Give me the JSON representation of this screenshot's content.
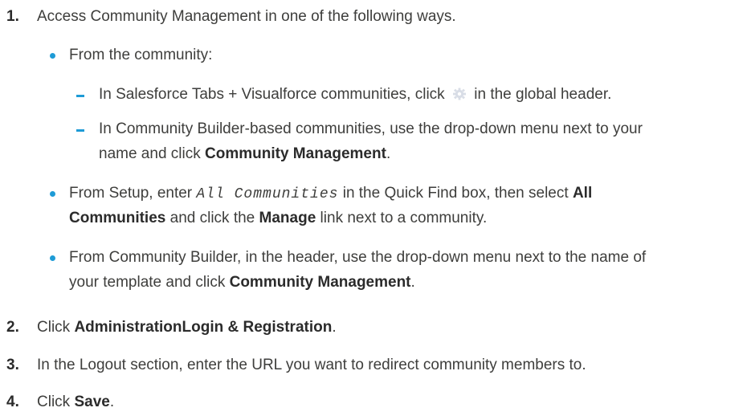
{
  "steps": [
    {
      "num": "1.",
      "text": "Access Community Management in one of the following ways."
    },
    {
      "num": "2.",
      "pre": "Click ",
      "bold": "AdministrationLogin & Registration",
      "post": "."
    },
    {
      "num": "3.",
      "text": "In the Logout section, enter the URL you want to redirect community members to."
    },
    {
      "num": "4.",
      "pre": "Click ",
      "bold": "Save",
      "post": "."
    }
  ],
  "ways": {
    "community": {
      "label": "From the community:",
      "tabs_pre": "In Salesforce Tabs + Visualforce communities, click ",
      "tabs_post": " in the global header.",
      "builder_line1": "In Community Builder-based communities, use the drop-down menu next to your",
      "builder_line2_pre": "name and click ",
      "builder_line2_bold": "Community Management",
      "builder_line2_post": "."
    },
    "setup": {
      "line1_pre": "From Setup, enter ",
      "line1_code": "All Communities",
      "line1_mid": " in the Quick Find box, then select ",
      "line1_bold": "All",
      "line2_bold1": "Communities",
      "line2_mid": " and click the ",
      "line2_bold2": "Manage",
      "line2_post": " link next to a community."
    },
    "builder": {
      "line1": "From Community Builder, in the header, use the drop-down menu next to the name of",
      "line2_pre": "your template and click ",
      "line2_bold": "Community Management",
      "line2_post": "."
    }
  },
  "icons": {
    "gear": "gear-icon",
    "bullet": "bullet-dot-icon",
    "dash": "dash-icon"
  },
  "colors": {
    "text": "#3e3e3c",
    "accent": "#1e9bd6",
    "gear": "#d8dde6"
  }
}
